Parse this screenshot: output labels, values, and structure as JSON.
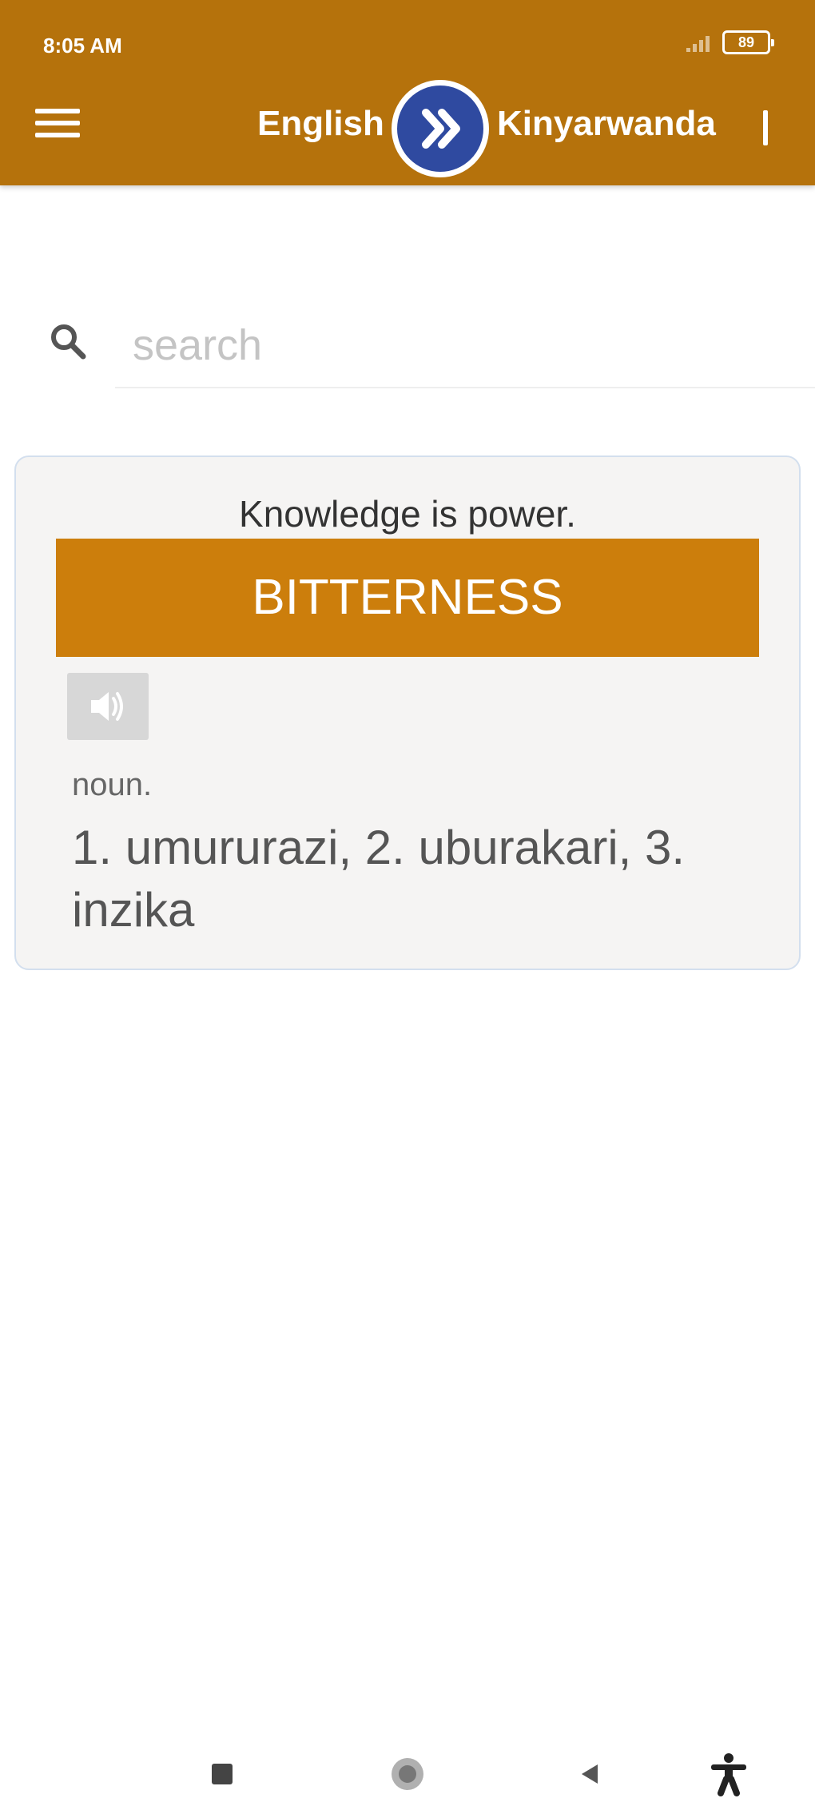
{
  "status_bar": {
    "time": "8:05 AM",
    "battery": "89"
  },
  "app_bar": {
    "source_language": "English",
    "target_language": "Kinyarwanda",
    "menu_icon": "hamburger-menu-icon",
    "swap_icon": "fast-forward-icon",
    "overflow_icon": "overflow-menu-icon"
  },
  "search": {
    "placeholder": "search",
    "value": ""
  },
  "card": {
    "quote": "Knowledge is power.",
    "word": "BITTERNESS",
    "speak_icon": "speaker-icon",
    "part_of_speech": "noun.",
    "meanings": "1. umururazi, 2. uburakari, 3. inzika"
  },
  "system_nav": [
    "recents-icon",
    "home-icon",
    "back-icon",
    "accessibility-icon"
  ],
  "colors": {
    "app_bar": "#b5720c",
    "word_banner": "#cc7e0c",
    "swap_button": "#2f4aa0",
    "card_bg": "#f5f4f3"
  }
}
